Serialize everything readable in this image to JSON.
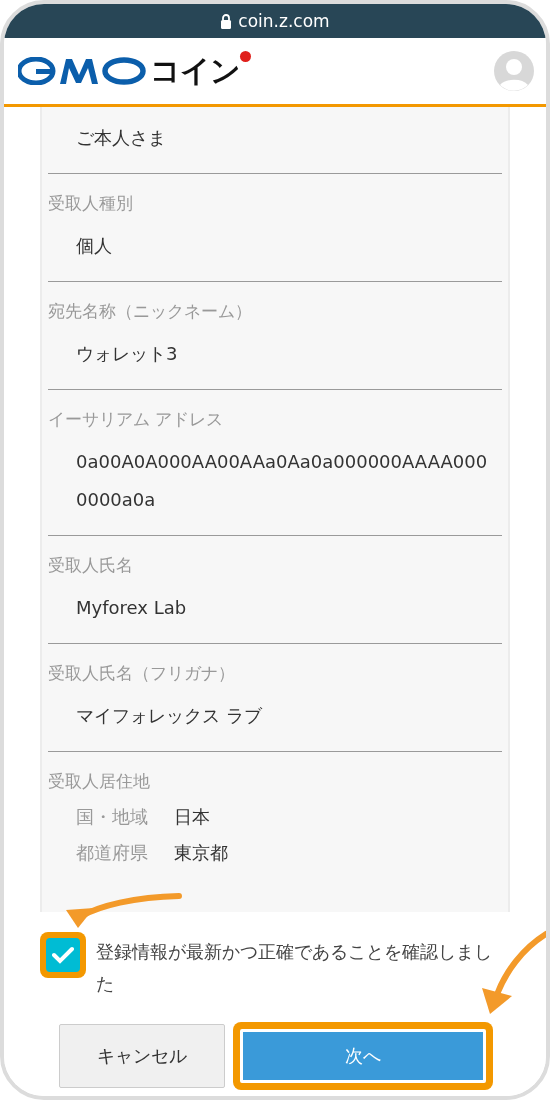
{
  "browser_bar": {
    "url": "coin.z.com"
  },
  "header": {
    "logo_text": "コイン"
  },
  "fields": [
    {
      "kind": "text",
      "value": "ご本人さま"
    },
    {
      "kind": "text",
      "label": "受取人種別",
      "value": "個人"
    },
    {
      "kind": "text",
      "label": "宛先名称（ニックネーム）",
      "value": "ウォレット3"
    },
    {
      "kind": "text",
      "label": "イーサリアム アドレス",
      "value": "0a00A0A000AA00AAa0Aa0a000000AAAA0000000a0a"
    },
    {
      "kind": "text",
      "label": "受取人氏名",
      "value": "Myforex Lab"
    },
    {
      "kind": "text",
      "label": "受取人氏名（フリガナ）",
      "value": "マイフォレックス ラブ"
    },
    {
      "kind": "pairs",
      "label": "受取人居住地",
      "pairs": [
        {
          "key": "国・地域",
          "value": "日本"
        },
        {
          "key": "都道府県",
          "value": "東京都"
        }
      ]
    }
  ],
  "confirm": {
    "label": "登録情報が最新かつ正確であることを確認しました",
    "checked": true,
    "highlighted": true
  },
  "buttons": [
    {
      "kind": "secondary",
      "label": "キャンセル",
      "highlighted": false
    },
    {
      "kind": "primary",
      "label": "次へ",
      "highlighted": true
    }
  ]
}
